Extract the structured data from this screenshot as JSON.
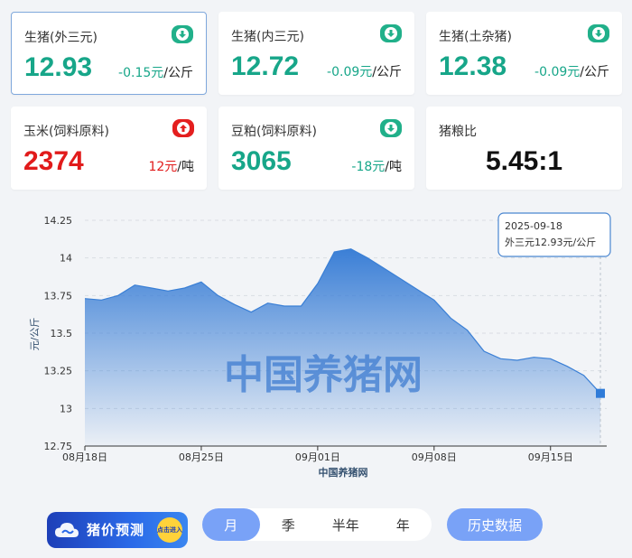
{
  "cards": [
    {
      "title": "生猪(外三元)",
      "price": "12.93",
      "change": "-0.15元",
      "unit": "/公斤",
      "dir": "down",
      "color": "green"
    },
    {
      "title": "生猪(内三元)",
      "price": "12.72",
      "change": "-0.09元",
      "unit": "/公斤",
      "dir": "down",
      "color": "green"
    },
    {
      "title": "生猪(土杂猪)",
      "price": "12.38",
      "change": "-0.09元",
      "unit": "/公斤",
      "dir": "down",
      "color": "green"
    },
    {
      "title": "玉米(饲料原料)",
      "price": "2374",
      "change": "12元",
      "unit": "/吨",
      "dir": "up",
      "color": "red"
    },
    {
      "title": "豆粕(饲料原料)",
      "price": "3065",
      "change": "-18元",
      "unit": "/吨",
      "dir": "down",
      "color": "green"
    },
    {
      "title": "猪粮比",
      "value": "5.45:1"
    }
  ],
  "colors": {
    "green": "#17a689",
    "red": "#e11b1b",
    "accent": "#79a2f7",
    "line": "#3a7fd5"
  },
  "chart_data": {
    "type": "area",
    "ylabel": "元/公斤",
    "xlabel": "中国养猪网",
    "watermark": "中国养猪网",
    "ylim": [
      12.75,
      14.25
    ],
    "yticks": [
      "12.75",
      "13",
      "13.25",
      "13.5",
      "13.75",
      "14",
      "14.25"
    ],
    "xticks": [
      {
        "label": "08月18日",
        "date": "2025-08-18"
      },
      {
        "label": "08月25日",
        "date": "2025-08-25"
      },
      {
        "label": "09月01日",
        "date": "2025-09-01"
      },
      {
        "label": "09月08日",
        "date": "2025-09-08"
      },
      {
        "label": "09月15日",
        "date": "2025-09-15"
      }
    ],
    "x": [
      "2025-08-18",
      "2025-08-19",
      "2025-08-20",
      "2025-08-21",
      "2025-08-22",
      "2025-08-23",
      "2025-08-24",
      "2025-08-25",
      "2025-08-26",
      "2025-08-27",
      "2025-08-28",
      "2025-08-29",
      "2025-08-30",
      "2025-08-31",
      "2025-09-01",
      "2025-09-02",
      "2025-09-03",
      "2025-09-04",
      "2025-09-05",
      "2025-09-06",
      "2025-09-07",
      "2025-09-08",
      "2025-09-09",
      "2025-09-10",
      "2025-09-11",
      "2025-09-12",
      "2025-09-13",
      "2025-09-14",
      "2025-09-15",
      "2025-09-16",
      "2025-09-17",
      "2025-09-18"
    ],
    "series": [
      {
        "values": [
          13.73,
          13.72,
          13.75,
          13.82,
          13.8,
          13.78,
          13.8,
          13.84,
          13.75,
          13.69,
          13.64,
          13.7,
          13.68,
          13.68,
          13.83,
          14.04,
          14.06,
          14.0,
          13.93,
          13.86,
          13.79,
          13.72,
          13.6,
          13.52,
          13.38,
          13.33,
          13.32,
          13.34,
          13.33,
          13.28,
          13.22,
          13.1,
          12.93
        ]
      }
    ],
    "tooltip": {
      "date": "2025-09-18",
      "text": "外三元12.93元/公斤"
    }
  },
  "forecast": {
    "label": "猪价预测",
    "enter": "点击进入"
  },
  "period": {
    "tabs": [
      "月",
      "季",
      "半年",
      "年"
    ],
    "active": 0
  },
  "history_label": "历史数据"
}
